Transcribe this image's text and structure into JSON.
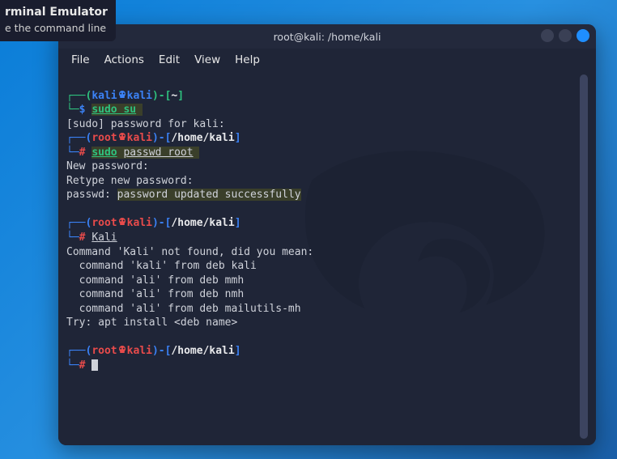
{
  "tooltip": {
    "title": "rminal Emulator",
    "sub": "e the command line"
  },
  "window": {
    "title": "root@kali: /home/kali"
  },
  "menu": {
    "file": "File",
    "actions": "Actions",
    "edit": "Edit",
    "view": "View",
    "help": "Help"
  },
  "term": {
    "p1": {
      "user": "kali",
      "host": "kali",
      "path": "~",
      "sym": "$",
      "cmd": "sudo su"
    },
    "l_sudo_pw": "[sudo] password for kali:",
    "p2": {
      "user": "root",
      "host": "kali",
      "path": "/home/kali",
      "sym": "#",
      "cmd1": "sudo",
      "cmd2": "passwd root"
    },
    "l_newpw": "New password:",
    "l_retype": "Retype new password:",
    "l_passwd_pre": "passwd: ",
    "l_passwd_ok": "password updated successfully",
    "p3": {
      "user": "root",
      "host": "kali",
      "path": "/home/kali",
      "sym": "#",
      "cmd": "Kali"
    },
    "nf1": "Command 'Kali' not found, did you mean:",
    "nf2": "  command 'kali' from deb kali",
    "nf3": "  command 'ali' from deb mmh",
    "nf4": "  command 'ali' from deb nmh",
    "nf5": "  command 'ali' from deb mailutils-mh",
    "nf6": "Try: apt install <deb name>",
    "p4": {
      "user": "root",
      "host": "kali",
      "path": "/home/kali",
      "sym": "#"
    }
  }
}
